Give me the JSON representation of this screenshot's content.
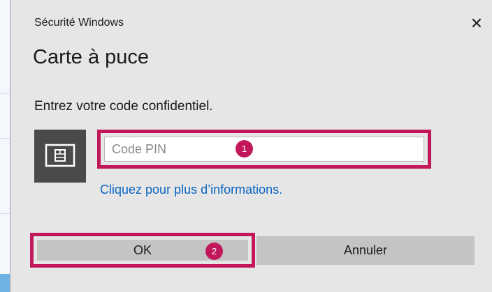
{
  "window": {
    "title": "Sécurité Windows",
    "close_icon": "close-icon"
  },
  "dialog": {
    "heading": "Carte à puce",
    "prompt": "Entrez votre code confidentiel.",
    "smartcard_icon": "smartcard-icon"
  },
  "pin": {
    "placeholder": "Code PIN",
    "value": ""
  },
  "link": {
    "label": "Cliquez pour plus d’informations."
  },
  "buttons": {
    "ok_label": "OK",
    "cancel_label": "Annuler"
  },
  "annotations": {
    "badge_1": "1",
    "badge_2": "2",
    "highlight_color": "#c2185b"
  },
  "colors": {
    "dialog_bg": "#e6e6e6",
    "button_bg": "#c4c4c4",
    "link": "#0a64c2",
    "tile": "#4a4a4a"
  }
}
